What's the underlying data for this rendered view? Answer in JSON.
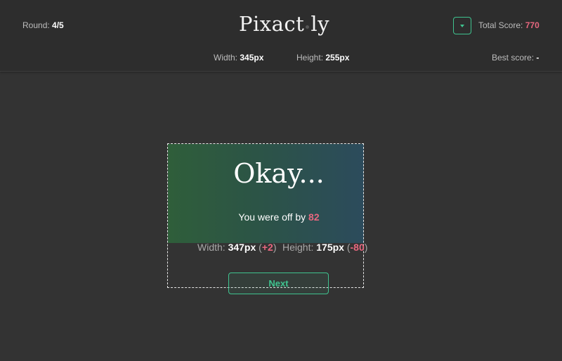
{
  "header": {
    "round_label": "Round:",
    "round_value": "4/5",
    "logo_left": "Pixact",
    "logo_right": "ly",
    "total_label": "Total Score:",
    "total_value": "770",
    "target_width_label": "Width:",
    "target_width_value": "345px",
    "target_height_label": "Height:",
    "target_height_value": "255px",
    "best_label": "Best score:",
    "best_value": "-"
  },
  "result": {
    "verdict": "Okay...",
    "offby_label": "You were off by",
    "offby_value": "82",
    "width_label": "Width:",
    "width_value": "347px",
    "width_diff": "+2",
    "height_label": "Height:",
    "height_value": "175px",
    "height_diff": "-80"
  },
  "next_button": {
    "label": "Next"
  },
  "icons": {
    "menu": "dropdown-caret-icon"
  },
  "colors": {
    "accent_green": "#3fc38f",
    "score_pink": "#e8677f",
    "background": "#333333",
    "header_bg": "#2d2d2d"
  }
}
